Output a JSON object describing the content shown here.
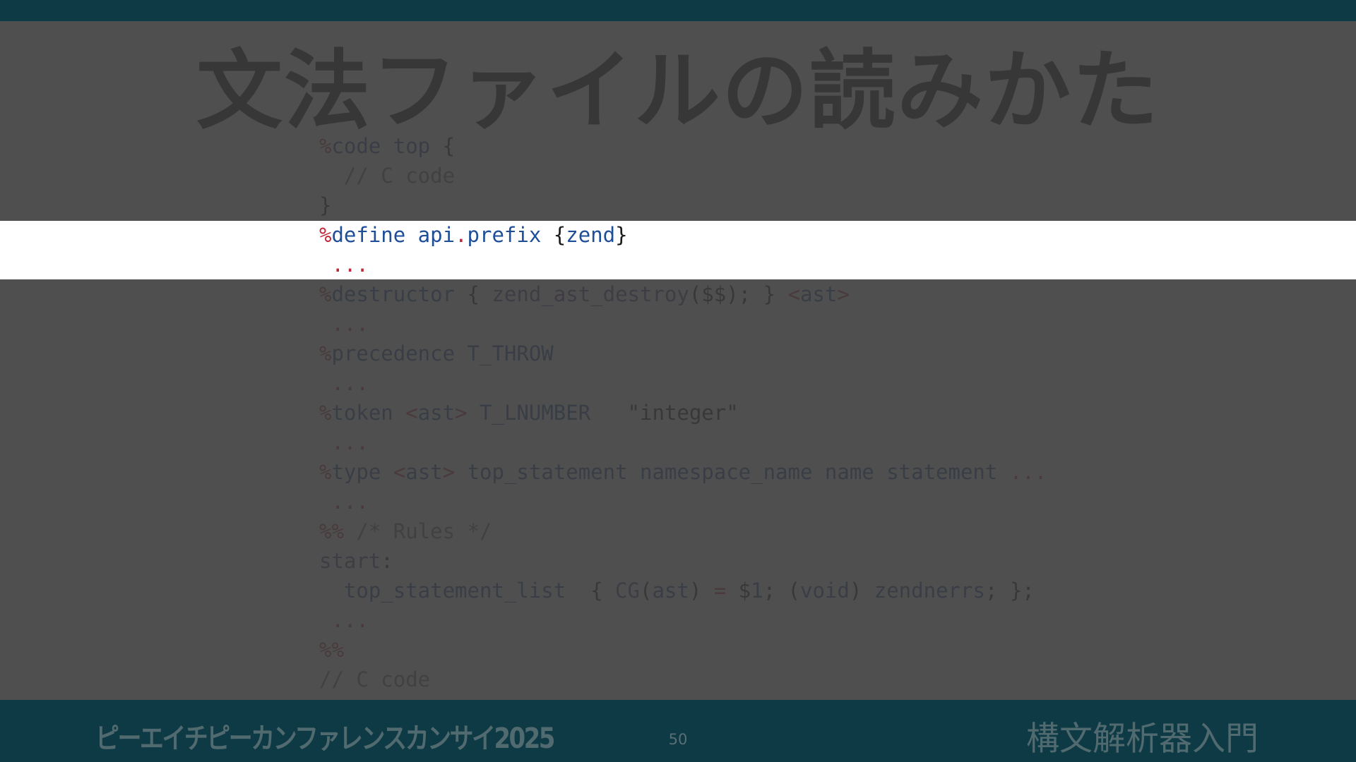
{
  "slide": {
    "title": "文法ファイルの読みかた",
    "code_lines": [
      [
        {
          "t": "%",
          "c": "kw"
        },
        {
          "t": "code top",
          "c": "id"
        },
        {
          "t": " {",
          "c": "pl"
        }
      ],
      [
        {
          "t": "  // C code",
          "c": "cm"
        }
      ],
      [
        {
          "t": "}",
          "c": "pl"
        }
      ],
      [
        {
          "t": "%",
          "c": "kw"
        },
        {
          "t": "define api",
          "c": "id"
        },
        {
          "t": ".",
          "c": "kw"
        },
        {
          "t": "prefix",
          "c": "id"
        },
        {
          "t": " {",
          "c": "pl"
        },
        {
          "t": "zend",
          "c": "id"
        },
        {
          "t": "}",
          "c": "pl"
        }
      ],
      [
        {
          "t": " ...",
          "c": "kw"
        }
      ],
      [
        {
          "t": "%",
          "c": "kw"
        },
        {
          "t": "destructor",
          "c": "id"
        },
        {
          "t": " { ",
          "c": "pl"
        },
        {
          "t": "zend_ast_destroy",
          "c": "fn"
        },
        {
          "t": "($$); } ",
          "c": "pl"
        },
        {
          "t": "<",
          "c": "kw"
        },
        {
          "t": "ast",
          "c": "id"
        },
        {
          "t": ">",
          "c": "kw"
        }
      ],
      [
        {
          "t": " ...",
          "c": "kw"
        }
      ],
      [
        {
          "t": "%",
          "c": "kw"
        },
        {
          "t": "precedence T_THROW",
          "c": "id"
        }
      ],
      [
        {
          "t": " ...",
          "c": "kw"
        }
      ],
      [
        {
          "t": "%",
          "c": "kw"
        },
        {
          "t": "token ",
          "c": "id"
        },
        {
          "t": "<",
          "c": "kw"
        },
        {
          "t": "ast",
          "c": "id"
        },
        {
          "t": ">",
          "c": "kw"
        },
        {
          "t": " T_LNUMBER",
          "c": "id"
        },
        {
          "t": "   \"integer\"",
          "c": "st"
        }
      ],
      [
        {
          "t": " ...",
          "c": "kw"
        }
      ],
      [
        {
          "t": "%",
          "c": "kw"
        },
        {
          "t": "type ",
          "c": "id"
        },
        {
          "t": "<",
          "c": "kw"
        },
        {
          "t": "ast",
          "c": "id"
        },
        {
          "t": ">",
          "c": "kw"
        },
        {
          "t": " top_statement namespace_name name statement ",
          "c": "id"
        },
        {
          "t": "...",
          "c": "kw"
        }
      ],
      [
        {
          "t": " ...",
          "c": "kw"
        }
      ],
      [
        {
          "t": "%%",
          "c": "kw"
        },
        {
          "t": " /* Rules */",
          "c": "cm"
        }
      ],
      [
        {
          "t": "start",
          "c": "fn"
        },
        {
          "t": ":",
          "c": "pl"
        }
      ],
      [
        {
          "t": "  top_statement_list",
          "c": "id"
        },
        {
          "t": "  { ",
          "c": "pl"
        },
        {
          "t": "CG",
          "c": "fn"
        },
        {
          "t": "(",
          "c": "pl"
        },
        {
          "t": "ast",
          "c": "id"
        },
        {
          "t": ") ",
          "c": "pl"
        },
        {
          "t": "=",
          "c": "kw"
        },
        {
          "t": " $",
          "c": "pl"
        },
        {
          "t": "1",
          "c": "id"
        },
        {
          "t": "; (",
          "c": "pl"
        },
        {
          "t": "void",
          "c": "id"
        },
        {
          "t": ") ",
          "c": "pl"
        },
        {
          "t": "zendnerrs",
          "c": "id"
        },
        {
          "t": "; };",
          "c": "pl"
        }
      ],
      [
        {
          "t": " ...",
          "c": "kw"
        }
      ],
      [
        {
          "t": "%%",
          "c": "kw"
        }
      ],
      [
        {
          "t": "// C code",
          "c": "cm"
        }
      ]
    ]
  },
  "footer": {
    "conference": "ピーエイチピーカンファレンスカンサイ2025",
    "page_number": "50",
    "subject": "構文解析器入門"
  },
  "colors": {
    "bar": "#0e3a45",
    "keyword": "#c0293a",
    "identifier": "#1f4e98",
    "comment": "#6e6e6e"
  }
}
